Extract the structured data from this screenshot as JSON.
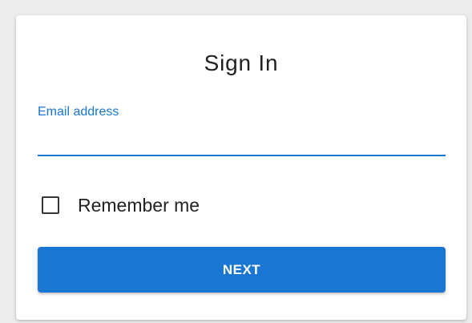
{
  "colors": {
    "accent": "#1976d2",
    "background": "#ececec",
    "card": "#ffffff"
  },
  "sign_in": {
    "title": "Sign In",
    "email": {
      "label": "Email address",
      "value": "",
      "placeholder": ""
    },
    "remember_me": {
      "label": "Remember me",
      "checked": false
    },
    "next_label": "NEXT"
  }
}
